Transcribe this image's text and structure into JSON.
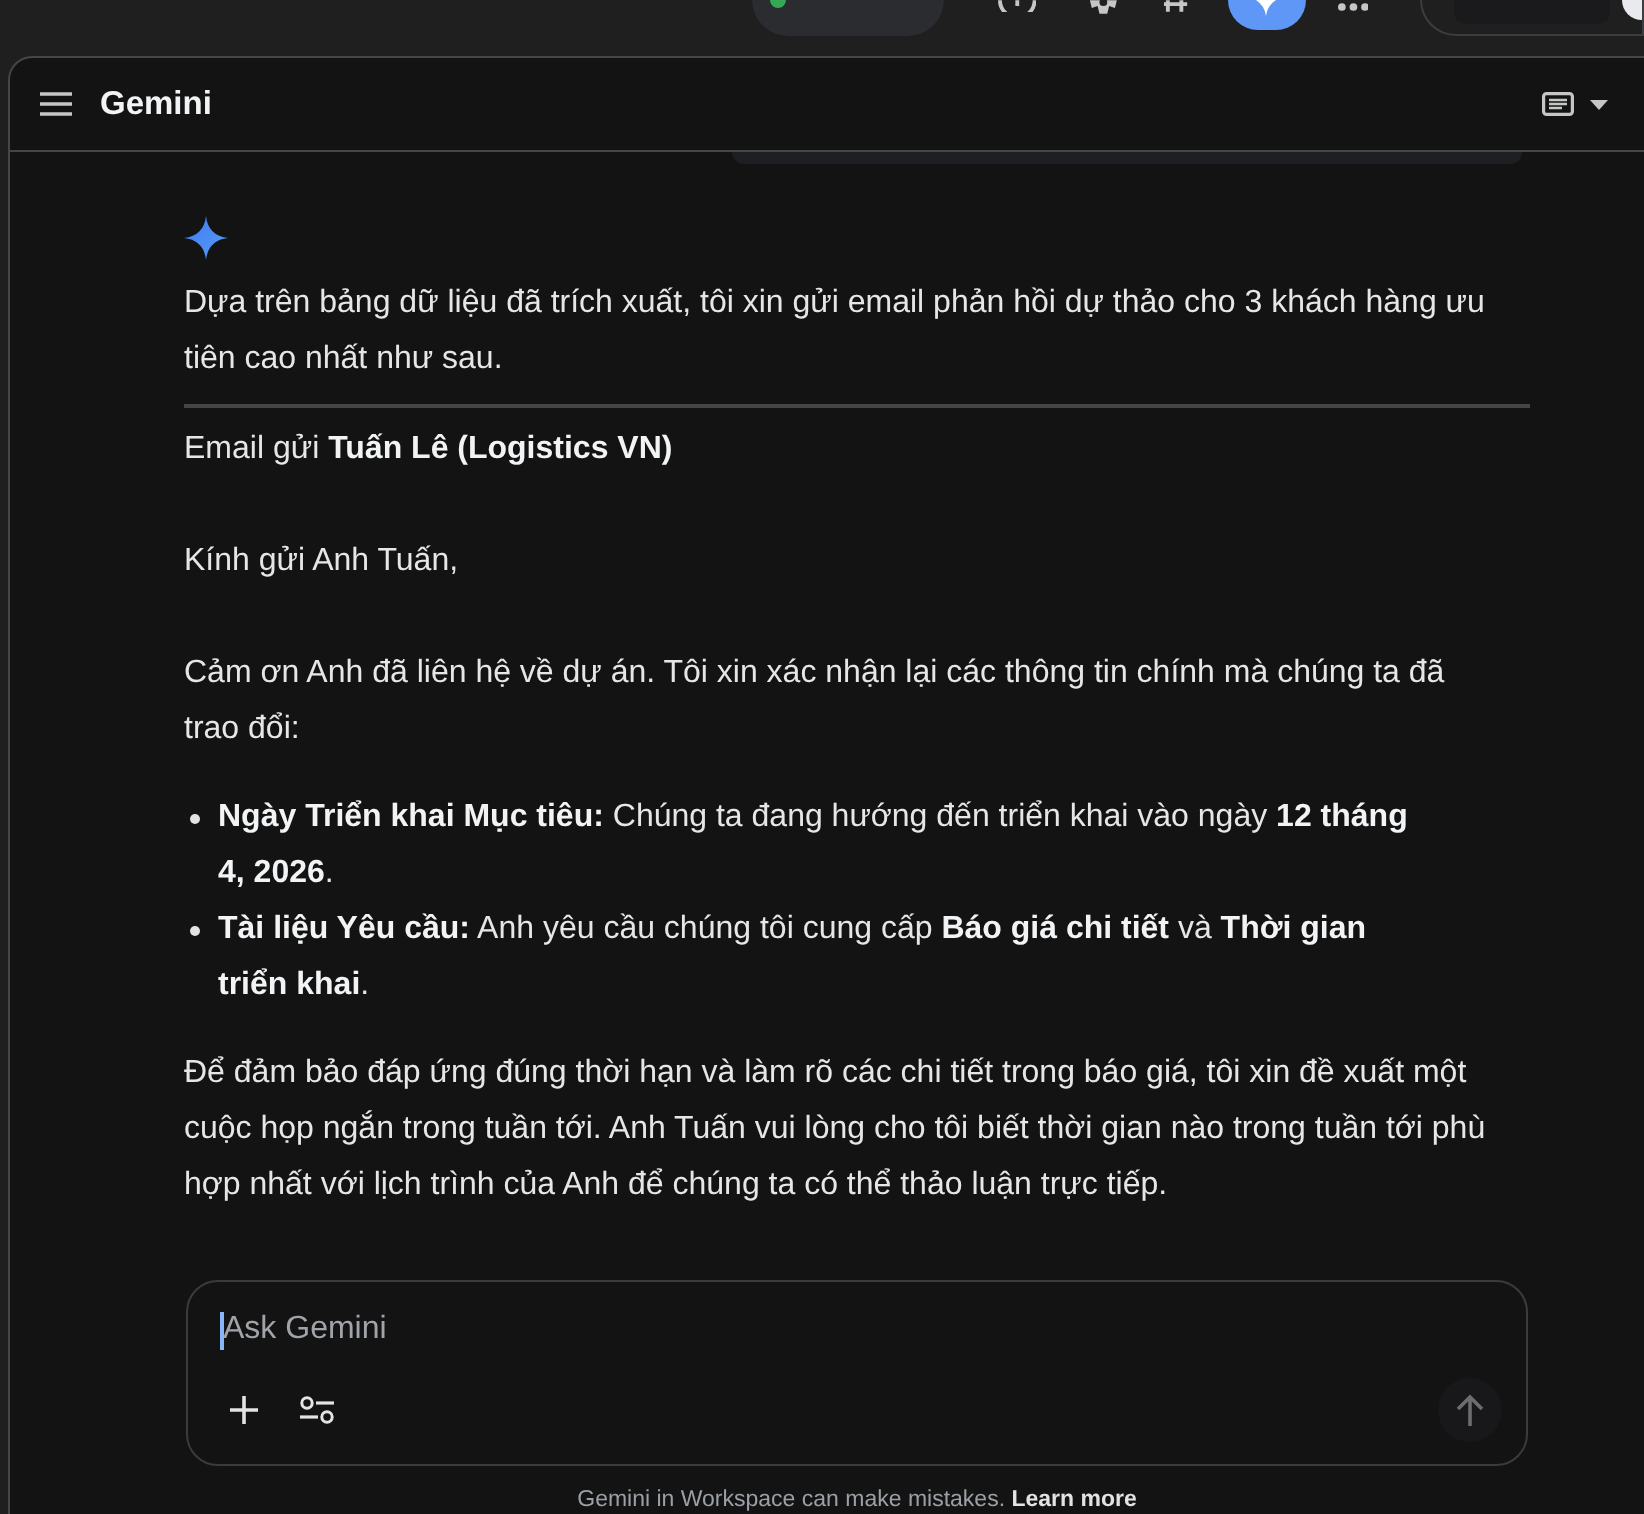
{
  "header": {
    "title": "Gemini"
  },
  "response": {
    "intro": "Dựa trên bảng dữ liệu đã trích xuất, tôi xin gửi email phản hồi dự thảo cho 3 khách hàng ưu tiên cao nhất như sau.",
    "email_heading": "Email gửi **Tuấn Lê (Logistics VN)**",
    "body": [
      {
        "kind": "paragraph",
        "text": "Kính gửi Anh Tuấn,"
      },
      {
        "kind": "paragraph",
        "text": "Cảm ơn Anh đã liên hệ về dự án. Tôi xin xác nhận lại các thông tin chính mà chúng ta đã trao đổi:"
      },
      {
        "kind": "list",
        "items": [
          "**Ngày Triển khai Mục tiêu:** Chúng ta đang hướng đến triển khai vào ngày **12 tháng 4, 2026**.",
          "**Tài liệu Yêu cầu:** Anh yêu cầu chúng tôi cung cấp **Báo giá chi tiết** và **Thời gian triển khai**."
        ]
      },
      {
        "kind": "paragraph",
        "text": "Để đảm bảo đáp ứng đúng thời hạn và làm rõ các chi tiết trong báo giá, tôi xin đề xuất một cuộc họp ngắn trong tuần tới. Anh Tuấn vui lòng cho tôi biết thời gian nào trong tuần tới phù hợp nhất với lịch trình của Anh để chúng ta có thể thảo luận trực tiếp."
      }
    ]
  },
  "composer": {
    "placeholder": "Ask Gemini",
    "send_button": {
      "disabled": true
    }
  },
  "footer": {
    "text": "Gemini in Workspace can make mistakes.",
    "link": "Learn more"
  }
}
